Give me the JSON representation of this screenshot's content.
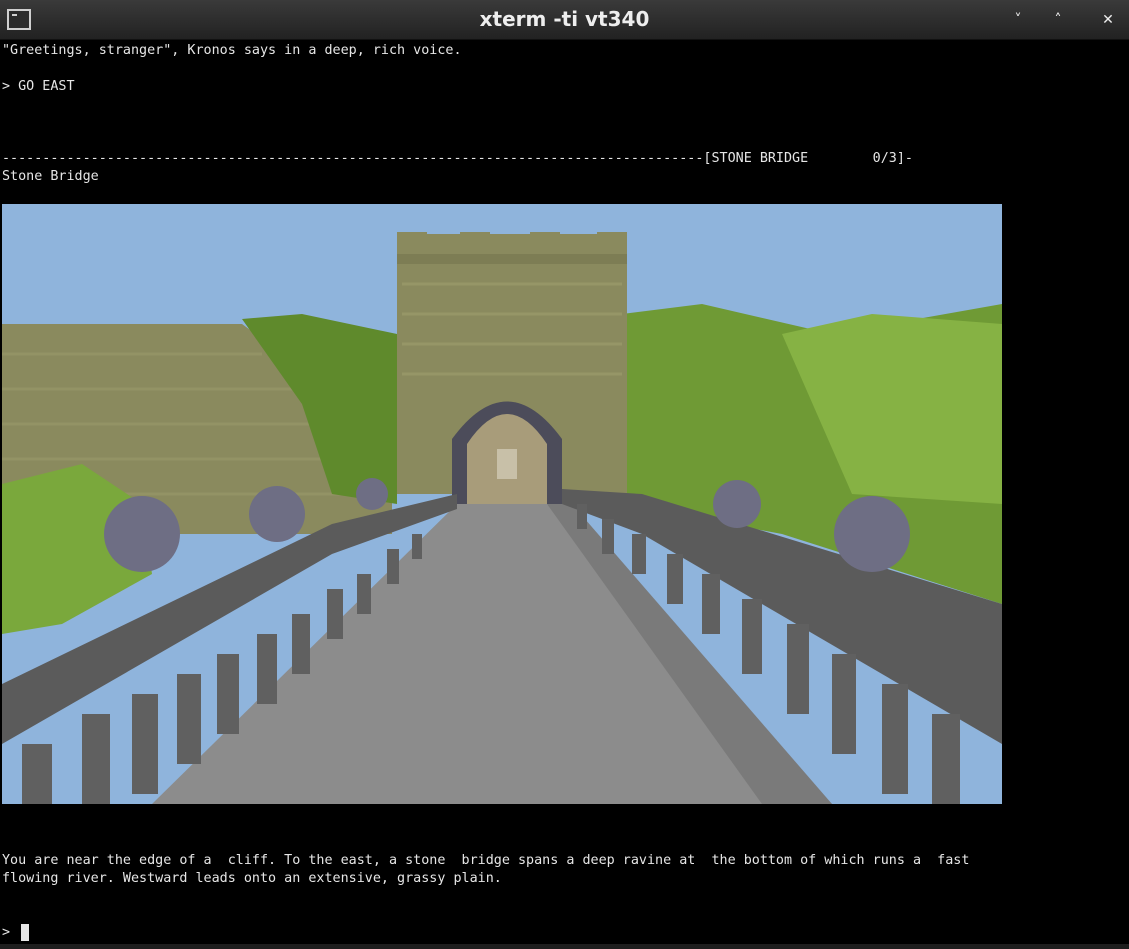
{
  "window": {
    "title": "xterm -ti vt340",
    "icon": "terminal-icon",
    "controls": {
      "minimize": "˅",
      "maximize": "˄",
      "close": "✕"
    }
  },
  "terminal": {
    "greeting": "\"Greetings, stranger\", Kronos says in a deep, rich voice.",
    "command": "> GO EAST",
    "status_bar": "---------------------------------------------------------------------------------------[STONE BRIDGE        0/3]-",
    "location": "Stone Bridge",
    "description_line1": "You are near the edge of a  cliff. To the east, a stone  bridge spans a deep ravine at  the bottom of which runs a  fast",
    "description_line2": "flowing river. Westward leads onto an extensive, grassy plain.",
    "prompt": ">"
  },
  "colors": {
    "sky": "#8fb4dc",
    "stone": "#8a8a5e",
    "foliage": "#6f9a35",
    "bridge": "#8c8c8c",
    "railing": "#5b5b5b"
  }
}
